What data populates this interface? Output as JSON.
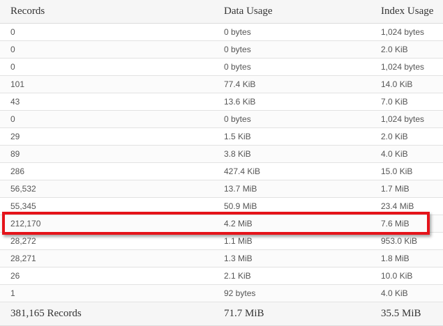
{
  "table": {
    "headers": {
      "records": "Records",
      "data_usage": "Data Usage",
      "index_usage": "Index Usage"
    },
    "rows": [
      {
        "records": "0",
        "data_usage": "0 bytes",
        "index_usage": "1,024 bytes"
      },
      {
        "records": "0",
        "data_usage": "0 bytes",
        "index_usage": "2.0 KiB"
      },
      {
        "records": "0",
        "data_usage": "0 bytes",
        "index_usage": "1,024 bytes"
      },
      {
        "records": "101",
        "data_usage": "77.4 KiB",
        "index_usage": "14.0 KiB"
      },
      {
        "records": "43",
        "data_usage": "13.6 KiB",
        "index_usage": "7.0 KiB"
      },
      {
        "records": "0",
        "data_usage": "0 bytes",
        "index_usage": "1,024 bytes"
      },
      {
        "records": "29",
        "data_usage": "1.5 KiB",
        "index_usage": "2.0 KiB"
      },
      {
        "records": "89",
        "data_usage": "3.8 KiB",
        "index_usage": "4.0 KiB"
      },
      {
        "records": "286",
        "data_usage": "427.4 KiB",
        "index_usage": "15.0 KiB"
      },
      {
        "records": "56,532",
        "data_usage": "13.7 MiB",
        "index_usage": "1.7 MiB"
      },
      {
        "records": "55,345",
        "data_usage": "50.9 MiB",
        "index_usage": "23.4 MiB"
      },
      {
        "records": "212,170",
        "data_usage": "4.2 MiB",
        "index_usage": "7.6 MiB"
      },
      {
        "records": "28,272",
        "data_usage": "1.1 MiB",
        "index_usage": "953.0 KiB"
      },
      {
        "records": "28,271",
        "data_usage": "1.3 MiB",
        "index_usage": "1.8 MiB"
      },
      {
        "records": "26",
        "data_usage": "2.1 KiB",
        "index_usage": "10.0 KiB"
      },
      {
        "records": "1",
        "data_usage": "92 bytes",
        "index_usage": "4.0 KiB"
      }
    ],
    "footer": {
      "records": "381,165 Records",
      "data_usage": "71.7 MiB",
      "index_usage": "35.5 MiB"
    }
  },
  "highlight": {
    "color": "#e5131a",
    "row_index": 11
  }
}
